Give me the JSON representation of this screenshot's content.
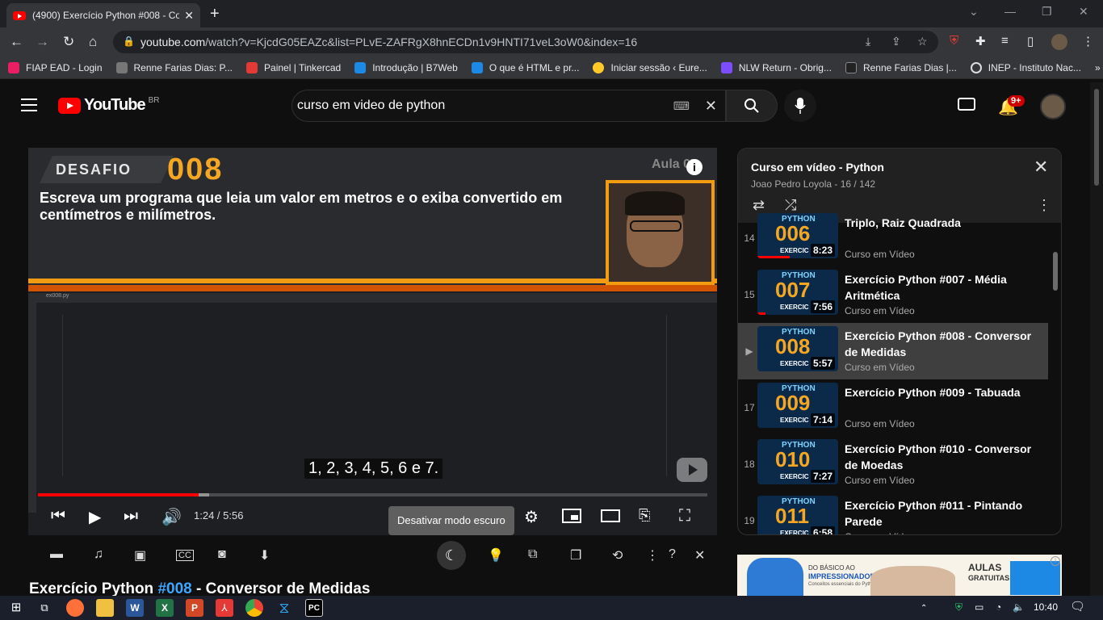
{
  "browser": {
    "tab_title": "(4900) Exercício Python #008 - Co",
    "url_host": "youtube.com",
    "url_path": "/watch?v=KjcdG05EAZc&list=PLvE-ZAFRgX8hnECDn1v9HNTI71veL3oW0&index=16",
    "bookmarks": [
      "FIAP EAD - Login",
      "Renne Farias Dias: P...",
      "Painel | Tinkercad",
      "Introdução | B7Web",
      "O que é HTML e pr...",
      "Iniciar sessão ‹ Eure...",
      "NLW Return - Obrig...",
      "Renne Farias Dias |...",
      "INEP - Instituto Nac..."
    ],
    "bookmark_colors": [
      "#e91e63",
      "#777",
      "#e53935",
      "#1e88e5",
      "#1e88e5",
      "#ffca28",
      "#7c4dff",
      "#222",
      "#ddd"
    ],
    "more": "»"
  },
  "youtube": {
    "logo_text": "YouTube",
    "country": "BR",
    "search_value": "curso em video de python",
    "notifications": "9+"
  },
  "video": {
    "slide_label": "DESAFIO",
    "slide_number": "008",
    "aula": "Aula 07",
    "info": "i",
    "statement": "Escreva um programa que leia um valor em metros e o exiba convertido em centímetros e milímetros.",
    "file_tab": "ex008.py",
    "caption": "1, 2, 3, 4, 5, 6 e 7.",
    "time": "1:24 / 5:56",
    "progress": 0.24,
    "tooltip": "Desativar modo escuro",
    "title_prefix": "Exercício Python ",
    "title_hash": "#008",
    "title_suffix": " - Conversor de Medidas"
  },
  "playlist": {
    "title": "Curso em vídeo - Python",
    "subtitle": "Joao Pedro Loyola - 16 / 142",
    "items": [
      {
        "idx": "14",
        "num": "006",
        "name": "Triplo, Raiz Quadrada",
        "channel": "Curso em Vídeo",
        "dur": "8:23",
        "watched": 0.4
      },
      {
        "idx": "15",
        "num": "007",
        "name": "Exercício Python #007 - Média Aritmética",
        "channel": "Curso em Vídeo",
        "dur": "7:56",
        "watched": 0.1
      },
      {
        "idx": "▶",
        "num": "008",
        "name": "Exercício Python #008 - Conversor de Medidas",
        "channel": "Curso em Vídeo",
        "dur": "5:57",
        "watched": 0
      },
      {
        "idx": "17",
        "num": "009",
        "name": "Exercício Python #009 - Tabuada",
        "channel": "Curso em Vídeo",
        "dur": "7:14",
        "watched": 0
      },
      {
        "idx": "18",
        "num": "010",
        "name": "Exercício Python #010 - Conversor de Moedas",
        "channel": "Curso em Vídeo",
        "dur": "7:27",
        "watched": 0
      },
      {
        "idx": "19",
        "num": "011",
        "name": "Exercício Python #011 - Pintando Parede",
        "channel": "Curso em Vídeo",
        "dur": "6:58",
        "watched": 0
      }
    ],
    "thumb_label": "PYTHON",
    "thumb_ex": "EXERCIC"
  },
  "ad": {
    "line1": "DO BÁSICO AO",
    "line2": "IMPRESSIONADOR",
    "line3": "Conceitos essenciais do Python, SQL e Ciência de Dados",
    "aulas": "AULAS",
    "gratuitas": "GRATUITAS"
  },
  "taskbar": {
    "clock": "10:40"
  }
}
